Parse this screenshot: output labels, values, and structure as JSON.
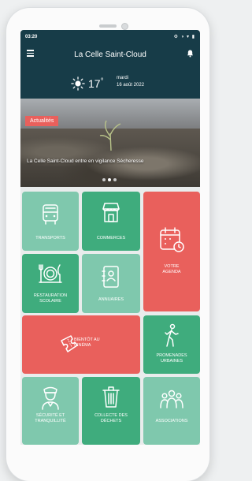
{
  "status_bar": {
    "time": "03:20",
    "icons_text": "⚙ ◑ ▾ ▮"
  },
  "header": {
    "title": "La Celle Saint-Cloud"
  },
  "weather": {
    "temperature": "17",
    "unit": "°",
    "day": "mardi",
    "date": "16 août 2022"
  },
  "news": {
    "badge": "Actualités",
    "caption": "La Celle Saint-Cloud entre en vigilance Sécheresse",
    "slides": 3,
    "active_slide": 1
  },
  "tiles": [
    {
      "id": "transports",
      "label": "TRANSPORTS",
      "icon": "bus-icon",
      "color": "#7fc8ad"
    },
    {
      "id": "commerces",
      "label": "COMMERCES",
      "icon": "shop-icon",
      "color": "#3fac7d"
    },
    {
      "id": "agenda",
      "label": "VOTRE AGENDA",
      "icon": "calendar-icon",
      "color": "#e9605c"
    },
    {
      "id": "restauration",
      "label": "RESTAURATION SCOLAIRE",
      "icon": "dining-icon",
      "color": "#3fac7d"
    },
    {
      "id": "annuaires",
      "label": "ANNUAIRES",
      "icon": "directory-icon",
      "color": "#7fc8ad"
    },
    {
      "id": "cinema",
      "label": "BIENTÔT AU CINÉMA",
      "icon": "ticket-icon",
      "color": "#e9605c"
    },
    {
      "id": "promenades",
      "label": "PROMENADES URBAINES",
      "icon": "walk-icon",
      "color": "#3fac7d"
    },
    {
      "id": "securite",
      "label": "SÉCURITÉ ET TRANQUILLITÉ",
      "icon": "police-icon",
      "color": "#7fc8ad"
    },
    {
      "id": "dechets",
      "label": "COLLECTE DES DÉCHETS",
      "icon": "trash-icon",
      "color": "#3fac7d"
    },
    {
      "id": "associations",
      "label": "ASSOCIATIONS",
      "icon": "people-icon",
      "color": "#7fc8ad"
    }
  ]
}
